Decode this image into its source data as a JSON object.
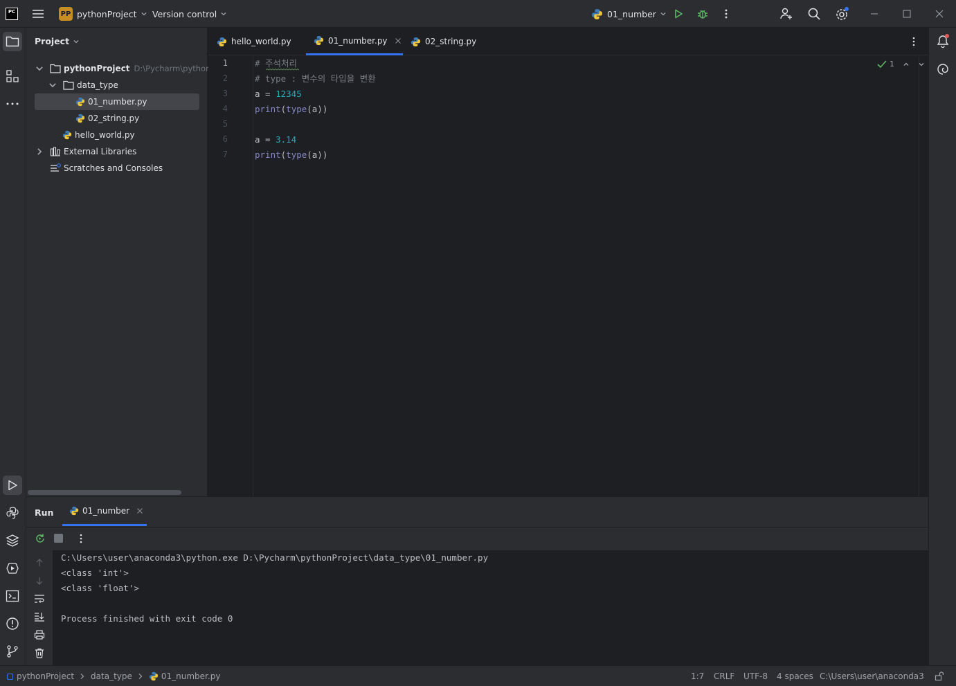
{
  "titlebar": {
    "app_icon_label": "PC",
    "project_badge": "PP",
    "project_name": "pythonProject",
    "version_control": "Version control",
    "run_config": "01_number"
  },
  "project_panel": {
    "title": "Project",
    "root": {
      "name": "pythonProject",
      "path": "D:\\Pycharm\\pythonPr"
    },
    "folder": "data_type",
    "files": [
      "01_number.py",
      "02_string.py"
    ],
    "root_file": "hello_world.py",
    "external_libraries": "External Libraries",
    "scratches": "Scratches and Consoles"
  },
  "editor": {
    "tabs": [
      "hello_world.py",
      "01_number.py",
      "02_string.py"
    ],
    "active_tab": 1,
    "inspection_count": "1",
    "line_numbers": [
      "1",
      "2",
      "3",
      "4",
      "5",
      "6",
      "7"
    ],
    "lines": {
      "l1": "# 주석처리",
      "l2": "# type : 변수의 타입을 변환",
      "l3_var": "a = ",
      "l3_num": "12345",
      "l4_fn1": "print",
      "l4_p1": "(",
      "l4_fn2": "type",
      "l4_rest": "(a))",
      "l6_var": "a = ",
      "l6_num": "3.14",
      "l7_fn1": "print",
      "l7_p1": "(",
      "l7_fn2": "type",
      "l7_rest": "(a))"
    }
  },
  "run_panel": {
    "title": "Run",
    "tab": "01_number",
    "output": [
      "C:\\Users\\user\\anaconda3\\python.exe D:\\Pycharm\\pythonProject\\data_type\\01_number.py",
      "<class 'int'>",
      "<class 'float'>",
      "",
      "Process finished with exit code 0"
    ]
  },
  "statusbar": {
    "breadcrumb": [
      "pythonProject",
      "data_type",
      "01_number.py"
    ],
    "position": "1:7",
    "line_ending": "CRLF",
    "encoding": "UTF-8",
    "indent": "4 spaces",
    "interpreter": "C:\\Users\\user\\anaconda3"
  },
  "colors": {
    "accent": "#3574f0",
    "run_green": "#5fb865",
    "number": "#2aacb8",
    "builtin": "#8888c6",
    "comment": "#7a7e85",
    "notification_badge": "#e55b5b"
  }
}
